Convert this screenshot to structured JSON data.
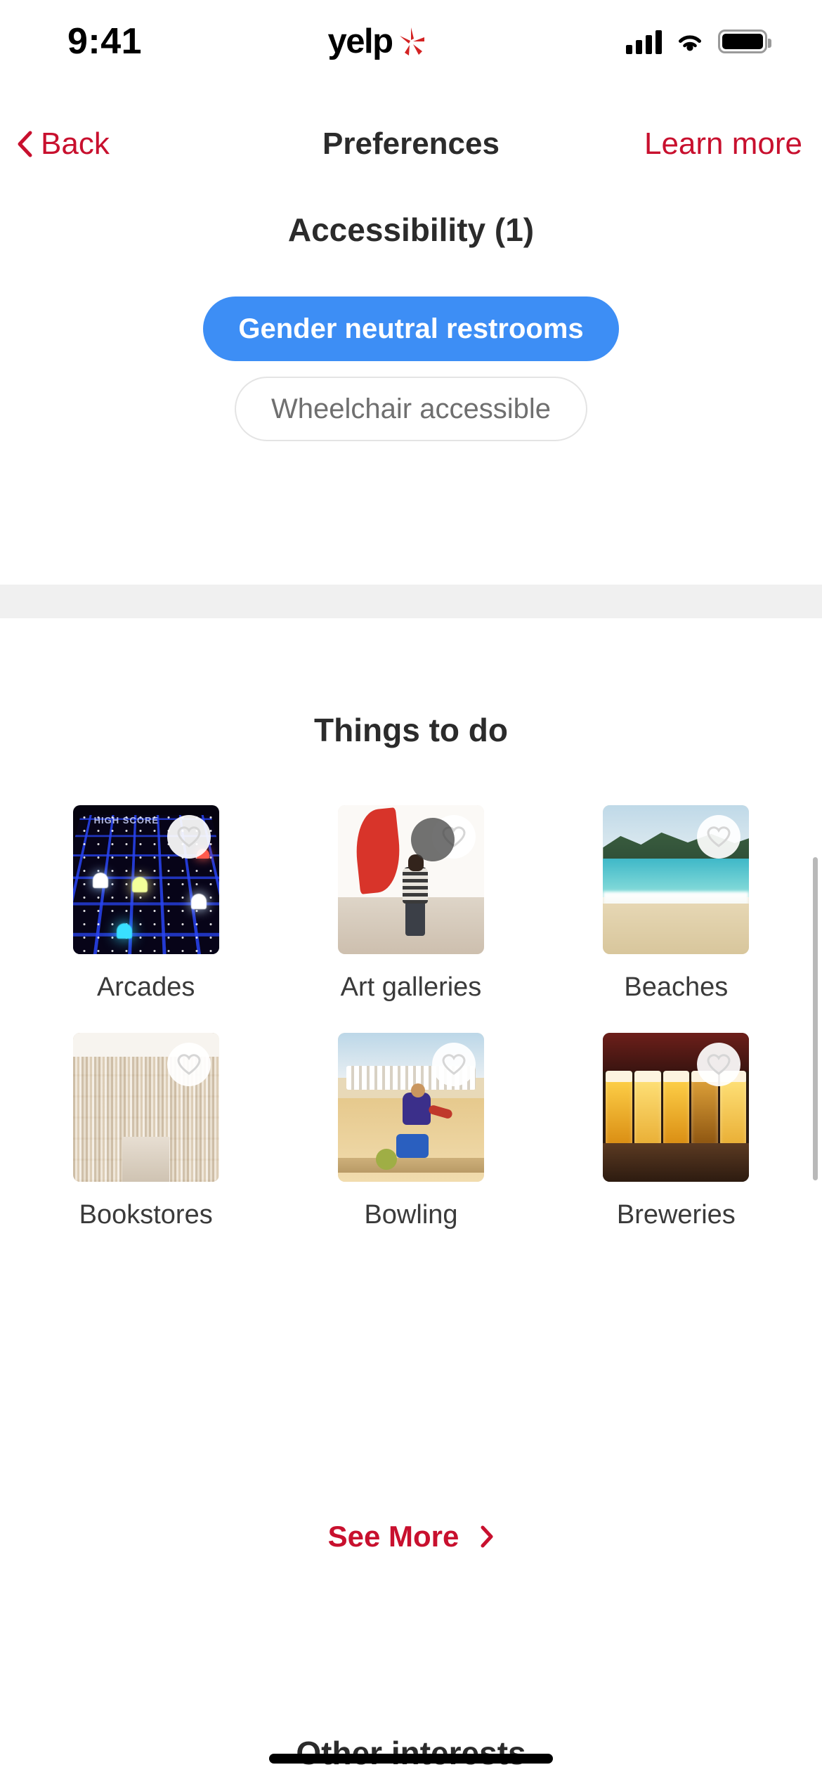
{
  "status_bar": {
    "time": "9:41",
    "brand": "yelp",
    "icons": [
      "cellular-signal-icon",
      "wifi-icon",
      "battery-icon"
    ]
  },
  "navbar": {
    "back_label": "Back",
    "title": "Preferences",
    "learn_more_label": "Learn more",
    "link_color": "#c8102e",
    "title_color": "#2b2b2b"
  },
  "accessibility": {
    "title": "Accessibility (1)",
    "selected_count": 1,
    "selected_color": "#3d8ef5",
    "chips": [
      {
        "label": "Gender neutral restrooms",
        "selected": true
      },
      {
        "label": "Wheelchair accessible",
        "selected": false
      }
    ]
  },
  "things_to_do": {
    "title": "Things to do",
    "tiles": [
      {
        "label": "Arcades",
        "art": "art-arcades",
        "favorite": false,
        "pressed": false
      },
      {
        "label": "Art galleries",
        "art": "art-gallery",
        "favorite": false,
        "pressed": true
      },
      {
        "label": "Beaches",
        "art": "art-beach",
        "favorite": false,
        "pressed": false
      },
      {
        "label": "Bookstores",
        "art": "art-books",
        "favorite": false,
        "pressed": false
      },
      {
        "label": "Bowling",
        "art": "art-bowling",
        "favorite": false,
        "pressed": false
      },
      {
        "label": "Breweries",
        "art": "art-brew",
        "favorite": false,
        "pressed": false
      }
    ],
    "see_more_label": "See More",
    "see_more_color": "#c8102e"
  },
  "other_interests": {
    "title": "Other interests"
  }
}
